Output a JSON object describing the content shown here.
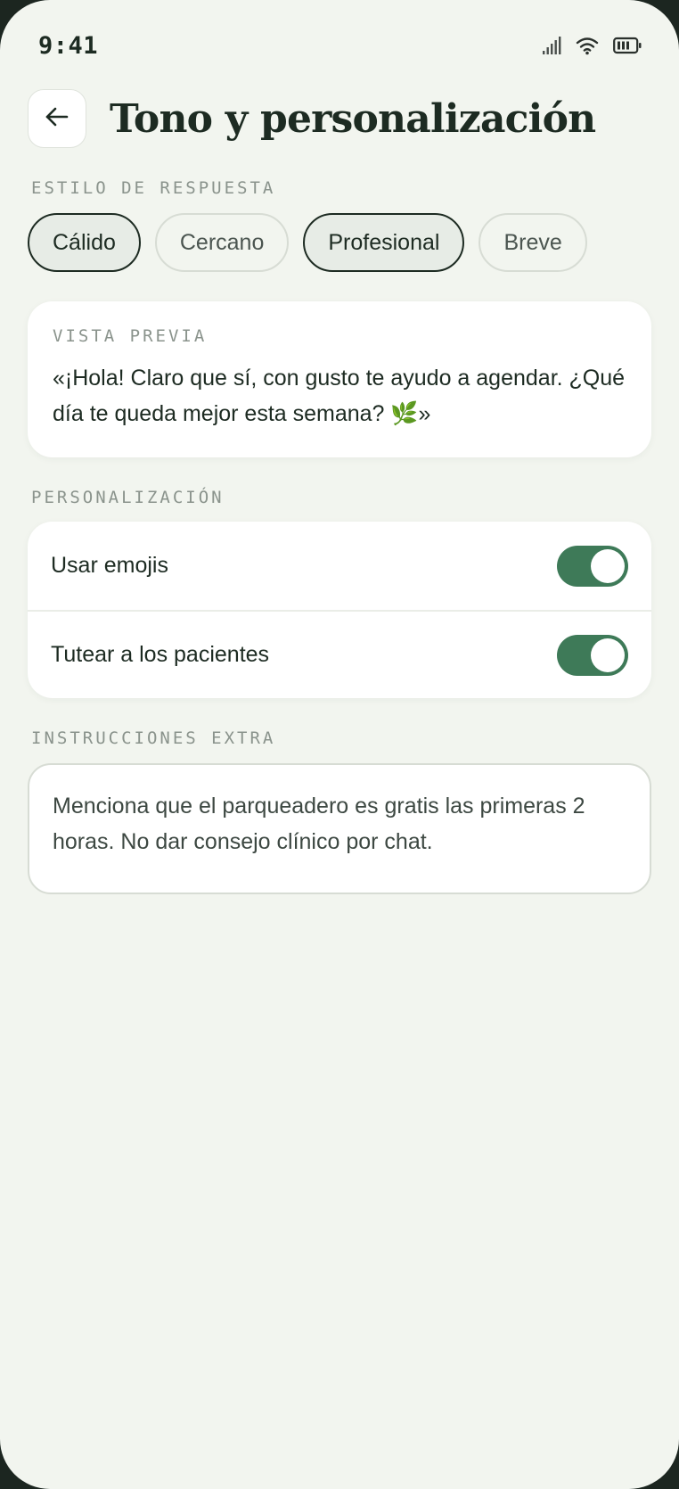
{
  "status_bar": {
    "time": "9:41"
  },
  "header": {
    "back_icon": "arrow-left-icon",
    "title": "Tono y personalización"
  },
  "response_style": {
    "section_label": "ESTILO DE RESPUESTA",
    "chips": [
      {
        "label": "Cálido",
        "selected": true
      },
      {
        "label": "Cercano",
        "selected": false
      },
      {
        "label": "Profesional",
        "selected": true
      },
      {
        "label": "Breve",
        "selected": false
      }
    ]
  },
  "preview": {
    "label": "VISTA PREVIA",
    "text": "«¡Hola! Claro que sí, con gusto te ayudo a agendar. ¿Qué día te queda mejor esta semana? 🌿»"
  },
  "personalization": {
    "section_label": "PERSONALIZACIÓN",
    "toggles": [
      {
        "label": "Usar emojis",
        "on": true
      },
      {
        "label": "Tutear a los pacientes",
        "on": true
      }
    ]
  },
  "extra_instructions": {
    "section_label": "INSTRUCCIONES EXTRA",
    "value": "Menciona que el parqueadero es gratis las primeras 2 horas. No dar consejo clínico por chat."
  },
  "colors": {
    "background": "#f2f5ef",
    "accent_green": "#3e7a58",
    "text_dark": "#1d2b22",
    "muted_label": "#8a938c"
  }
}
